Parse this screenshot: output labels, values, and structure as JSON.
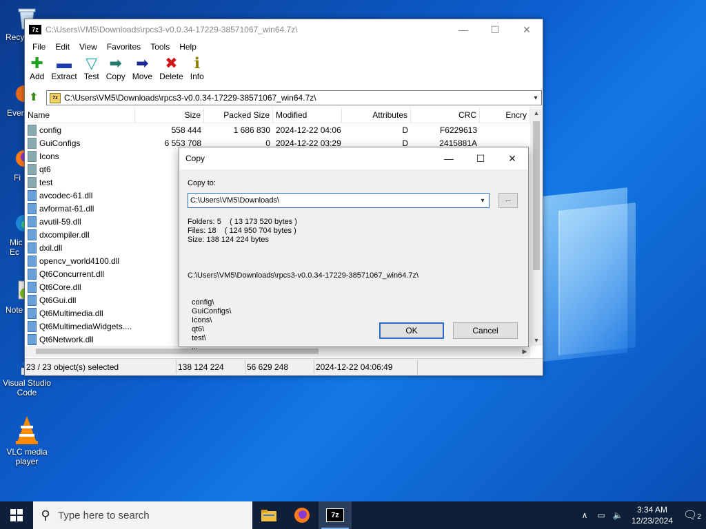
{
  "desktop": {
    "icons": [
      {
        "label": "Recy",
        "name": "recycle-bin"
      },
      {
        "label": "Ever",
        "name": "everything"
      },
      {
        "label": "Fi",
        "name": "firefox"
      },
      {
        "label": "Mic\nEc",
        "name": "microsoft-edge"
      },
      {
        "label": "Note",
        "name": "notepad-plus-plus"
      },
      {
        "label": "Visual Studio\nCode",
        "name": "vscode"
      },
      {
        "label": "VLC media\nplayer",
        "name": "vlc"
      }
    ]
  },
  "window": {
    "title": "C:\\Users\\VM5\\Downloads\\rpcs3-v0.0.34-17229-38571067_win64.7z\\",
    "logo": "7z",
    "controls": {
      "minimize": "—",
      "maximize": "☐",
      "close": "✕"
    },
    "menu": [
      "File",
      "Edit",
      "View",
      "Favorites",
      "Tools",
      "Help"
    ],
    "toolbar": [
      {
        "label": "Add",
        "icon": "add-icon",
        "glyph": "✚",
        "color": "#1aa01a"
      },
      {
        "label": "Extract",
        "icon": "extract-icon",
        "glyph": "▬",
        "color": "#1a3ab0"
      },
      {
        "label": "Test",
        "icon": "test-icon",
        "glyph": "▽",
        "color": "#20a0a0"
      },
      {
        "label": "Copy",
        "icon": "copy-icon",
        "glyph": "➡",
        "color": "#1f7a6a"
      },
      {
        "label": "Move",
        "icon": "move-icon",
        "glyph": "➡",
        "color": "#1a2a9a"
      },
      {
        "label": "Delete",
        "icon": "delete-icon",
        "glyph": "✖",
        "color": "#d01818"
      },
      {
        "label": "Info",
        "icon": "info-icon",
        "glyph": "ℹ",
        "color": "#8a7a00"
      }
    ],
    "address": "C:\\Users\\VM5\\Downloads\\rpcs3-v0.0.34-17229-38571067_win64.7z\\",
    "columns": [
      "Name",
      "Size",
      "Packed Size",
      "Modified",
      "Attributes",
      "CRC",
      "Encry"
    ],
    "rows": [
      {
        "type": "folder",
        "name": "config",
        "size": "558 444",
        "packed": "1 686 830",
        "modified": "2024-12-22 04:06",
        "attr": "D",
        "crc": "F6229613"
      },
      {
        "type": "folder",
        "name": "GuiConfigs",
        "size": "6 553 708",
        "packed": "0",
        "modified": "2024-12-22 03:29",
        "attr": "D",
        "crc": "2415881A"
      },
      {
        "type": "folder",
        "name": "Icons",
        "size": "22",
        "packed": "",
        "modified": "",
        "attr": "",
        "crc": ""
      },
      {
        "type": "folder",
        "name": "qt6",
        "size": "3 29",
        "packed": "",
        "modified": "",
        "attr": "",
        "crc": ""
      },
      {
        "type": "folder",
        "name": "test",
        "size": "2 57",
        "packed": "",
        "modified": "",
        "attr": "",
        "crc": ""
      },
      {
        "type": "file",
        "name": "avcodec-61.dll",
        "size": "13 41",
        "packed": "",
        "modified": "",
        "attr": "",
        "crc": ""
      },
      {
        "type": "file",
        "name": "avformat-61.dll",
        "size": "2 56",
        "packed": "",
        "modified": "",
        "attr": "",
        "crc": ""
      },
      {
        "type": "file",
        "name": "avutil-59.dll",
        "size": "1 19",
        "packed": "",
        "modified": "",
        "attr": "",
        "crc": ""
      },
      {
        "type": "file",
        "name": "dxcompiler.dll",
        "size": "14 07",
        "packed": "",
        "modified": "",
        "attr": "",
        "crc": ""
      },
      {
        "type": "file",
        "name": "dxil.dll",
        "size": "1 50",
        "packed": "",
        "modified": "",
        "attr": "",
        "crc": ""
      },
      {
        "type": "file",
        "name": "opencv_world4100.dll",
        "size": "9 50",
        "packed": "",
        "modified": "",
        "attr": "",
        "crc": ""
      },
      {
        "type": "file",
        "name": "Qt6Concurrent.dll",
        "size": "3",
        "packed": "",
        "modified": "",
        "attr": "",
        "crc": ""
      },
      {
        "type": "file",
        "name": "Qt6Core.dll",
        "size": "6 10",
        "packed": "",
        "modified": "",
        "attr": "",
        "crc": ""
      },
      {
        "type": "file",
        "name": "Qt6Gui.dll",
        "size": "9 23",
        "packed": "",
        "modified": "",
        "attr": "",
        "crc": ""
      },
      {
        "type": "file",
        "name": "Qt6Multimedia.dll",
        "size": "90",
        "packed": "",
        "modified": "",
        "attr": "",
        "crc": ""
      },
      {
        "type": "file",
        "name": "Qt6MultimediaWidgets....",
        "size": "",
        "packed": "",
        "modified": "",
        "attr": "",
        "crc": ""
      },
      {
        "type": "file",
        "name": "Qt6Network.dll",
        "size": "1 7",
        "packed": "",
        "modified": "",
        "attr": "",
        "crc": ""
      }
    ],
    "status": {
      "selected": "23 / 23 object(s) selected",
      "size": "138 124 224",
      "packed": "56 629 248",
      "modified": "2024-12-22 04:06:49"
    }
  },
  "dialog": {
    "title": "Copy",
    "controls": {
      "minimize": "—",
      "maximize": "☐",
      "close": "✕"
    },
    "copy_to_label": "Copy to:",
    "copy_to_value": "C:\\Users\\VM5\\Downloads\\",
    "browse_label": "...",
    "folders": "Folders: 5    ( 13 173 520 bytes )",
    "files": "Files: 18    ( 124 950 704 bytes )",
    "size": "Size: 138 124 224 bytes",
    "source_path": "C:\\Users\\VM5\\Downloads\\rpcs3-v0.0.34-17229-38571067_win64.7z\\",
    "tree": [
      "config\\",
      "GuiConfigs\\",
      "Icons\\",
      "qt6\\",
      "test\\",
      "..."
    ],
    "ok_label": "OK",
    "cancel_label": "Cancel"
  },
  "taskbar": {
    "search_placeholder": "Type here to search",
    "time": "3:34 AM",
    "date": "12/23/2024",
    "notification_count": "2",
    "apps": [
      "file-explorer",
      "firefox",
      "7-zip"
    ]
  }
}
